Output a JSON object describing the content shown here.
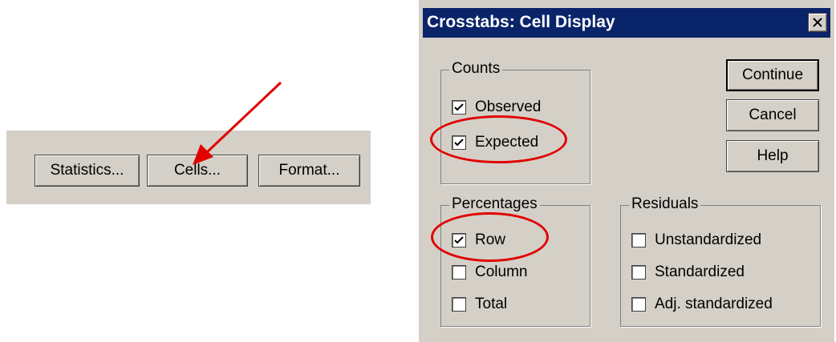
{
  "left_panel": {
    "buttons": [
      {
        "label": "Statistics..."
      },
      {
        "label": "Cells..."
      },
      {
        "label": "Format..."
      }
    ]
  },
  "dialog": {
    "title": "Crosstabs: Cell Display",
    "close_icon": "close-icon",
    "counts": {
      "label": "Counts",
      "items": [
        {
          "label": "Observed",
          "checked": true
        },
        {
          "label": "Expected",
          "checked": true
        }
      ]
    },
    "percentages": {
      "label": "Percentages",
      "items": [
        {
          "label": "Row",
          "checked": true
        },
        {
          "label": "Column",
          "checked": false
        },
        {
          "label": "Total",
          "checked": false
        }
      ]
    },
    "residuals": {
      "label": "Residuals",
      "items": [
        {
          "label": "Unstandardized",
          "checked": false
        },
        {
          "label": "Standardized",
          "checked": false
        },
        {
          "label": "Adj. standardized",
          "checked": false
        }
      ]
    },
    "buttons": {
      "continue": "Continue",
      "cancel": "Cancel",
      "help": "Help"
    }
  },
  "annotation_colors": {
    "highlight": "#e00000",
    "title_bar": "#0a246a",
    "face": "#d4d0c8"
  }
}
